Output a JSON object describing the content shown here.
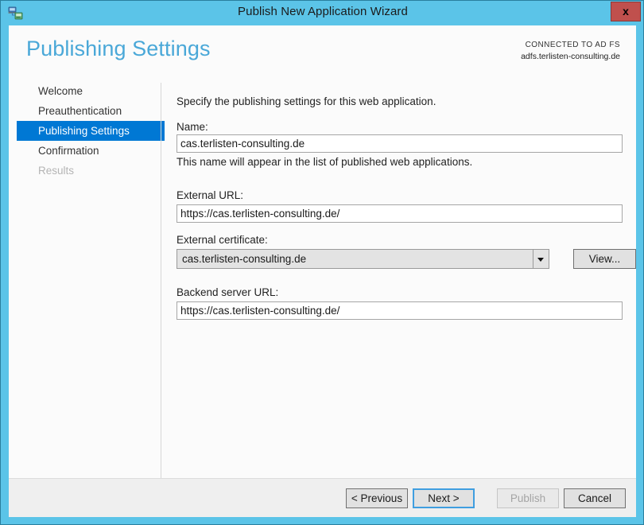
{
  "window": {
    "title": "Publish New Application Wizard",
    "icon": "network-application-icon",
    "close_label": "x",
    "accent_color": "#5bc4e8",
    "selection_color": "#0078d4"
  },
  "header": {
    "page_title": "Publishing Settings",
    "connected_label": "CONNECTED TO AD FS",
    "connected_value": "adfs.terlisten-consulting.de"
  },
  "sidebar": {
    "items": [
      {
        "label": "Welcome",
        "state": "normal"
      },
      {
        "label": "Preauthentication",
        "state": "normal"
      },
      {
        "label": "Publishing Settings",
        "state": "selected"
      },
      {
        "label": "Confirmation",
        "state": "normal"
      },
      {
        "label": "Results",
        "state": "disabled"
      }
    ]
  },
  "content": {
    "intro": "Specify the publishing settings for this web application.",
    "name_label": "Name:",
    "name_value": "cas.terlisten-consulting.de",
    "name_placeholder": "",
    "name_hint": "This name will appear in the list of published web applications.",
    "external_url_label": "External URL:",
    "external_url_value": "https://cas.terlisten-consulting.de/",
    "external_url_placeholder": "",
    "external_cert_label": "External certificate:",
    "external_cert_value": "cas.terlisten-consulting.de",
    "external_cert_arrow": "chevron-down-icon",
    "view_button": "View...",
    "backend_url_label": "Backend server URL:",
    "backend_url_value": "https://cas.terlisten-consulting.de/",
    "backend_url_placeholder": ""
  },
  "footer": {
    "previous": "< Previous",
    "next": "Next >",
    "publish": "Publish",
    "cancel": "Cancel"
  }
}
